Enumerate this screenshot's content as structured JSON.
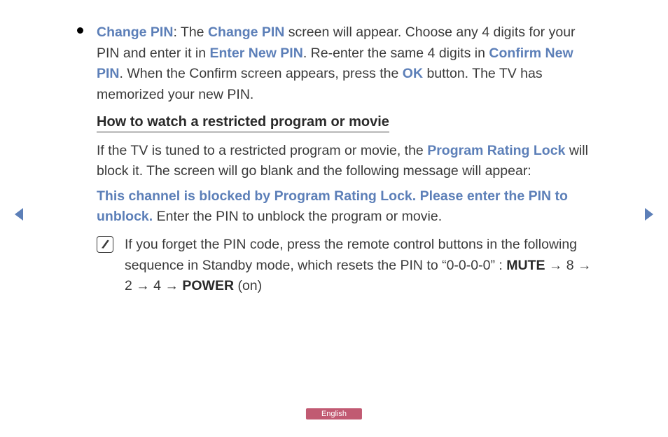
{
  "bullet": {
    "change_pin_label": "Change PIN",
    "text1": ": The ",
    "change_pin_screen": "Change PIN",
    "text2": " screen will appear. Choose any 4 digits for your PIN and enter it in ",
    "enter_new_pin": "Enter New PIN",
    "text3": ". Re-enter the same 4 digits in ",
    "confirm_new_pin": "Confirm New PIN",
    "text4": ". When the Confirm screen appears, press the ",
    "ok": "OK",
    "text5": " button. The TV has memorized your new PIN."
  },
  "heading": "How to watch a restricted program or movie",
  "para1": {
    "text1": "If the TV is tuned to a restricted program or movie, the ",
    "program_rating_lock": "Program Rating Lock",
    "text2": " will block it. The screen will go blank and the following message will appear:"
  },
  "para2": {
    "blocked_msg": "This channel is blocked by Program Rating Lock. Please enter the PIN to unblock.",
    "text1": " Enter the PIN to unblock the program or movie."
  },
  "note": {
    "text1": "If you forget the PIN code, press the remote control buttons in the following sequence in Standby mode, which resets the PIN to “0-0-0-0” : ",
    "mute": "MUTE",
    "seq": " → 8 → 2 → 4 → ",
    "power": "POWER",
    "on": " (on)"
  },
  "language": "English"
}
